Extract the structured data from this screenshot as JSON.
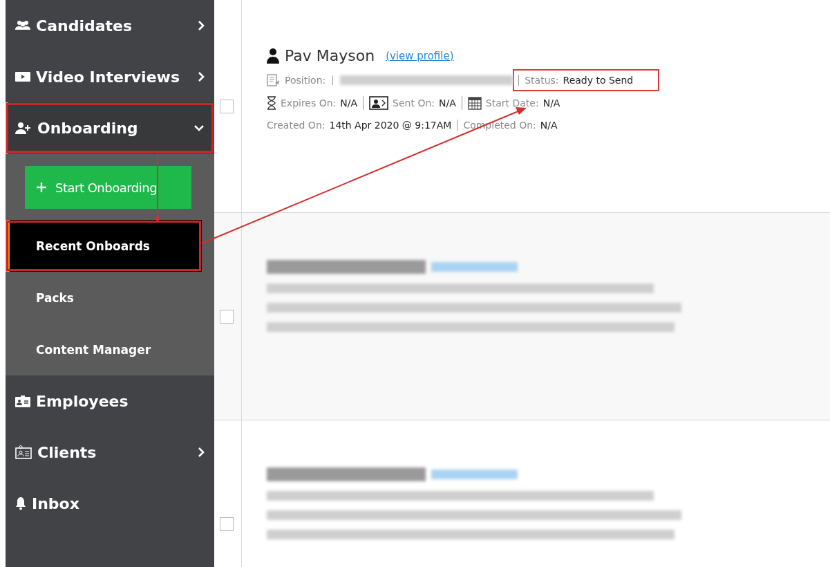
{
  "sidebar": {
    "items": [
      {
        "kind": "group",
        "label": "Candidates",
        "expanded": false,
        "highlighted": false
      },
      {
        "kind": "group",
        "label": "Video Interviews",
        "expanded": false,
        "highlighted": false
      },
      {
        "kind": "group",
        "label": "Onboarding",
        "expanded": true,
        "highlighted": true,
        "children": [
          {
            "kind": "button",
            "label": "Start Onboarding",
            "selected": false,
            "highlighted": false
          },
          {
            "kind": "link",
            "label": "Recent Onboards",
            "selected": true,
            "highlighted": true
          },
          {
            "kind": "link",
            "label": "Packs",
            "selected": false,
            "highlighted": false
          },
          {
            "kind": "link",
            "label": "Content Manager",
            "selected": false,
            "highlighted": false
          }
        ]
      },
      {
        "kind": "link",
        "label": "Employees",
        "highlighted": false
      },
      {
        "kind": "group",
        "label": "Clients",
        "expanded": false,
        "highlighted": false
      },
      {
        "kind": "link",
        "label": "Inbox",
        "highlighted": false
      }
    ]
  },
  "onboards": [
    {
      "kind": "record",
      "checked": false,
      "name": "Pav Mayson",
      "link": "(view profile)",
      "lines": [
        [
          {
            "label": "Position:",
            "redacted": true,
            "highlighted": false
          },
          {
            "label": "Status:",
            "value": "Ready to Send",
            "highlighted": true
          }
        ],
        [
          {
            "label": "Expires On:",
            "value": "N/A",
            "highlighted": false
          },
          {
            "label": "Sent On:",
            "value": "N/A",
            "highlighted": false
          },
          {
            "label": "Start Date:",
            "value": "N/A",
            "highlighted": false
          }
        ],
        [
          {
            "label": "Created On:",
            "value": "14th Apr 2020 @ 9:17AM",
            "highlighted": false
          },
          {
            "label": "Completed On:",
            "value": "N/A",
            "highlighted": false
          }
        ]
      ]
    },
    {
      "kind": "redacted",
      "checked": false
    },
    {
      "kind": "redacted",
      "checked": false
    }
  ]
}
